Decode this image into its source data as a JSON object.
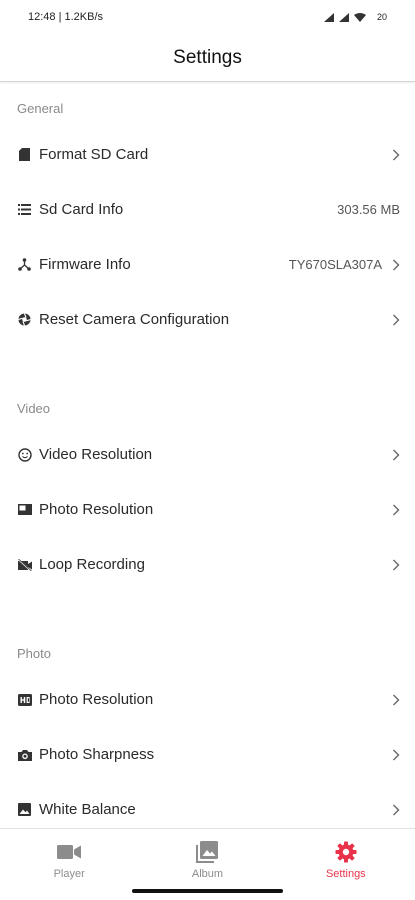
{
  "status_bar": {
    "time": "12:48 | 1.2KB/s",
    "battery": "20",
    "icons": [
      "signal-icon",
      "signal-icon",
      "wifi-icon",
      "battery-icon"
    ]
  },
  "header": {
    "title": "Settings"
  },
  "sections": {
    "general": {
      "title": "General",
      "items": [
        {
          "label": "Format SD Card",
          "icon": "sd-card-icon"
        },
        {
          "label": "Sd Card Info",
          "value": "303.56 MB",
          "icon": "list-icon"
        },
        {
          "label": "Firmware Info",
          "value": "TY670SLA307A",
          "icon": "firmware-icon"
        },
        {
          "label": "Reset Camera Configuration",
          "icon": "aperture-icon"
        }
      ]
    },
    "video": {
      "title": "Video",
      "items": [
        {
          "label": "Video Resolution",
          "icon": "smiley-icon"
        },
        {
          "label": "Photo Resolution",
          "icon": "photo-icon"
        },
        {
          "label": "Loop Recording",
          "icon": "loop-recording-icon"
        }
      ]
    },
    "photo": {
      "title": "Photo",
      "items": [
        {
          "label": "Photo Resolution",
          "icon": "hd-icon"
        },
        {
          "label": "Photo Sharpness",
          "icon": "camera-icon"
        },
        {
          "label": "White Balance",
          "icon": "image-icon"
        }
      ]
    }
  },
  "bottom_nav": {
    "active": "Settings",
    "active_color": "#e8334a",
    "items": [
      {
        "label": "Player",
        "icon": "video-camera-icon"
      },
      {
        "label": "Album",
        "icon": "album-icon"
      },
      {
        "label": "Settings",
        "icon": "gear-icon"
      }
    ]
  }
}
